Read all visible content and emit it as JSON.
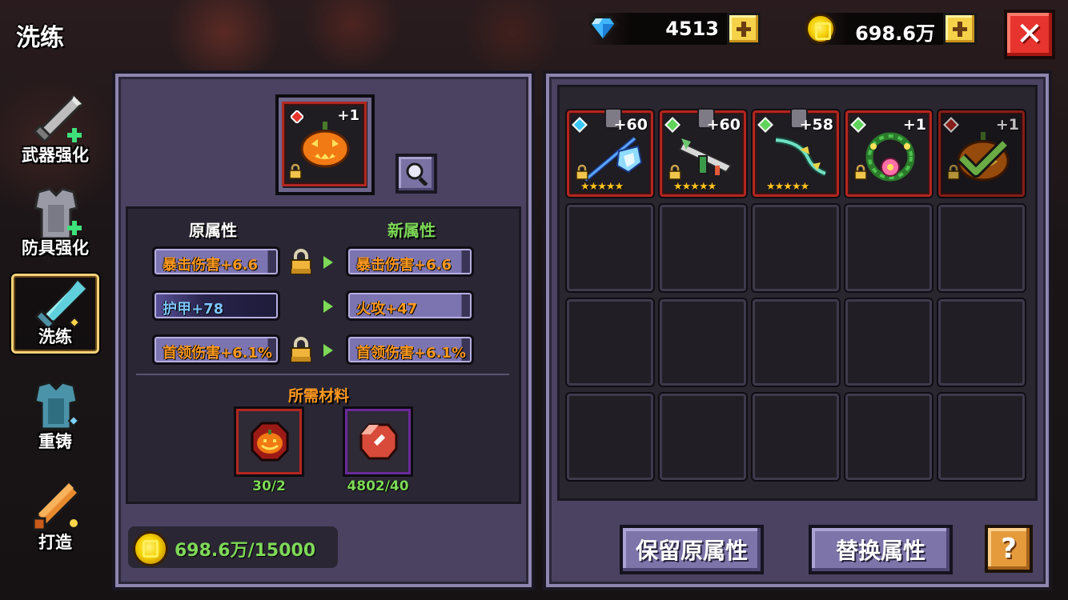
{
  "header": {
    "title": "洗练",
    "gems": "4513",
    "gold": "698.6万"
  },
  "sidebar": {
    "items": [
      {
        "label": "武器强化",
        "icon": "sword-upgrade-icon"
      },
      {
        "label": "防具强化",
        "icon": "armor-upgrade-icon"
      },
      {
        "label": "洗练",
        "icon": "sword-refine-icon",
        "active": true
      },
      {
        "label": "重铸",
        "icon": "armor-recast-icon"
      },
      {
        "label": "打造",
        "icon": "forge-icon"
      }
    ]
  },
  "refine": {
    "selected_item": {
      "level": "+1",
      "icon": "pumpkin-item-icon"
    },
    "original_header": "原属性",
    "new_header": "新属性",
    "rows": [
      {
        "original": "暴击伤害+6.6",
        "new": "暴击伤害+6.6",
        "locked": true
      },
      {
        "original": "护甲+78",
        "new": "火攻+47",
        "locked": false
      },
      {
        "original": "首领伤害+6.1%",
        "new": "首领伤害+6.1%",
        "locked": true
      }
    ],
    "materials_header": "所需材料",
    "materials": [
      {
        "icon": "pumpkin-material-icon",
        "count": "30/2"
      },
      {
        "icon": "red-gem-material-icon",
        "count": "4802/40"
      }
    ],
    "cost": "698.6万/15000"
  },
  "inventory": {
    "items": [
      {
        "level": "+60",
        "stars": "★★★★★",
        "icon": "ice-spear-icon",
        "rarity_color": "#39c6ff"
      },
      {
        "level": "+60",
        "stars": "★★★★★",
        "icon": "bone-crossbow-icon",
        "rarity_color": "#5fd35a"
      },
      {
        "level": "+58",
        "stars": "★★★★★",
        "icon": "jade-bow-icon",
        "rarity_color": "#5fd35a"
      },
      {
        "level": "+1",
        "stars": "",
        "icon": "flower-wreath-icon",
        "rarity_color": "#5fd35a"
      },
      {
        "level": "+1",
        "stars": "",
        "icon": "pumpkin-selected-icon",
        "rarity_color": "#b3261f"
      }
    ]
  },
  "actions": {
    "keep": "保留原属性",
    "replace": "替换属性",
    "help": "?"
  },
  "colors": {
    "orange_attr": "#ff9a1f",
    "blue_attr": "#7ec6ff",
    "green_header": "#7ed957",
    "material_header": "#ff9a1f"
  }
}
